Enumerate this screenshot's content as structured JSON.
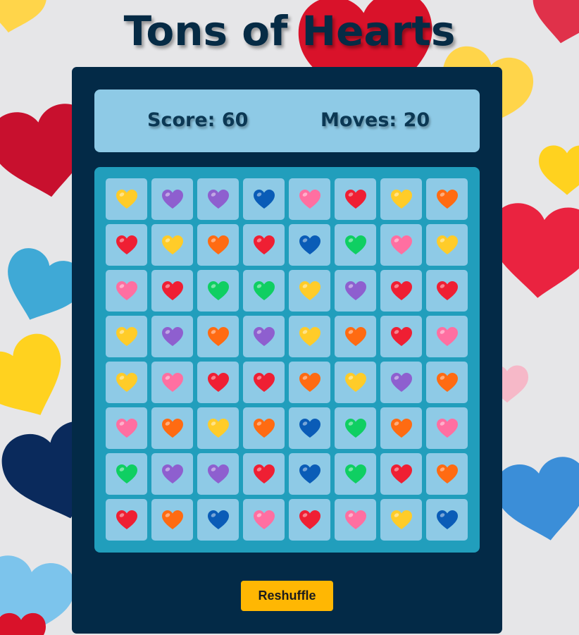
{
  "title": "Tons of Hearts",
  "scoreboard": {
    "score_text": "Score: 60",
    "moves_text": "Moves: 20"
  },
  "colors": {
    "yellow": "#ffcc29",
    "purple": "#8e5fcf",
    "blue": "#0a5cb7",
    "pink": "#ff6fa1",
    "red": "#ef1f33",
    "orange": "#ff6b12",
    "green": "#0fcf62",
    "panel": "#032a47",
    "board": "#219ebc",
    "tile": "#8ecae6",
    "button": "#ffb703"
  },
  "board": {
    "rows": [
      [
        "yellow",
        "purple",
        "purple",
        "blue",
        "pink",
        "red",
        "yellow",
        "orange"
      ],
      [
        "red",
        "yellow",
        "orange",
        "red",
        "blue",
        "green",
        "pink",
        "yellow"
      ],
      [
        "pink",
        "red",
        "green",
        "green",
        "yellow",
        "purple",
        "red",
        "red"
      ],
      [
        "yellow",
        "purple",
        "orange",
        "purple",
        "yellow",
        "orange",
        "red",
        "pink"
      ],
      [
        "yellow",
        "pink",
        "red",
        "red",
        "orange",
        "yellow",
        "purple",
        "orange"
      ],
      [
        "pink",
        "orange",
        "yellow",
        "orange",
        "blue",
        "green",
        "orange",
        "pink"
      ],
      [
        "green",
        "purple",
        "purple",
        "red",
        "blue",
        "green",
        "red",
        "orange"
      ],
      [
        "red",
        "orange",
        "blue",
        "pink",
        "red",
        "pink",
        "yellow",
        "blue"
      ]
    ]
  },
  "buttons": {
    "reshuffle_label": "Reshuffle"
  }
}
